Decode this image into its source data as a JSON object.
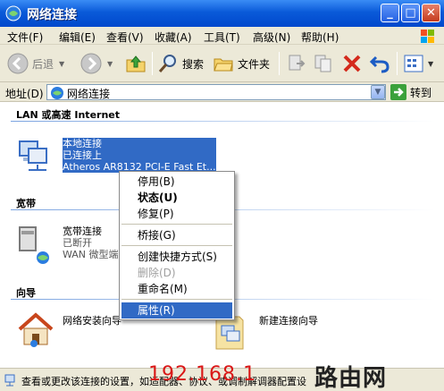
{
  "window": {
    "title": "网络连接"
  },
  "menu": [
    "文件(F)",
    "编辑(E)",
    "查看(V)",
    "收藏(A)",
    "工具(T)",
    "高级(N)",
    "帮助(H)"
  ],
  "toolbar": {
    "back": "后退",
    "search": "搜索",
    "folders": "文件夹"
  },
  "address": {
    "label": "地址(D)",
    "value": "网络连接",
    "go": "转到"
  },
  "groups": {
    "lan": "LAN 或高速 Internet",
    "broadband": "宽带",
    "wizard": "向导"
  },
  "connections": {
    "local": {
      "name": "本地连接",
      "status": "已连接上",
      "device": "Atheros AR8132 PCI-E Fast Et..."
    },
    "broadband": {
      "name": "宽带连接",
      "status": "已断开",
      "device": "WAN 微型端"
    },
    "setup_wizard": {
      "name": "网络安装向导"
    },
    "new_conn": {
      "name": "新建连接向导"
    }
  },
  "context_menu": {
    "disable": "停用(B)",
    "status": "状态(U)",
    "repair": "修复(P)",
    "bridge": "桥接(G)",
    "shortcut": "创建快捷方式(S)",
    "delete": "删除(D)",
    "rename": "重命名(M)",
    "properties": "属性(R)"
  },
  "status": {
    "text": "查看或更改该连接的设置，如适配器、协议、或调制解调器配置设"
  },
  "watermark": {
    "ip": "192.168.1",
    "brand": "路由网"
  }
}
